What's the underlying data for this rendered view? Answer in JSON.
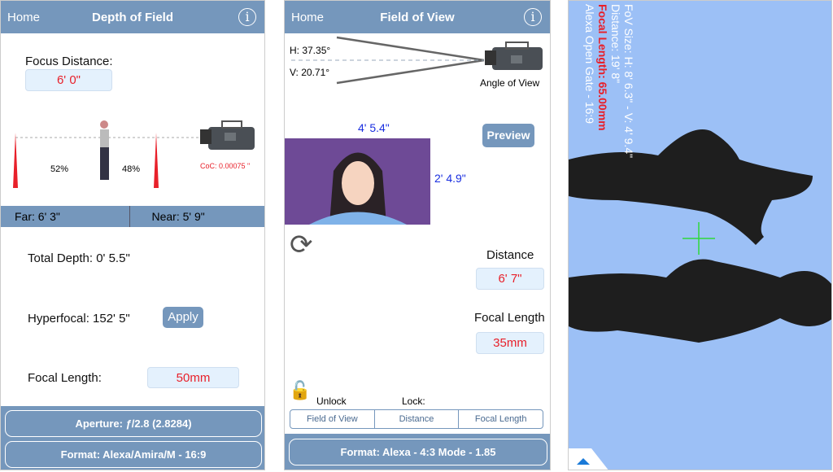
{
  "dof": {
    "home": "Home",
    "title": "Depth of Field",
    "focus_label": "Focus Distance:",
    "focus_value": "6' 0\"",
    "far_pct": "52%",
    "near_pct": "48%",
    "coc": "CoC: 0.00075 \"",
    "far": "Far: 6' 3\"",
    "near": "Near: 5' 9\"",
    "total_depth": "Total Depth: 0' 5.5\"",
    "hyperfocal": "Hyperfocal: 152' 5\"",
    "apply": "Apply",
    "focal_label": "Focal Length:",
    "focal_value": "50mm",
    "aperture": "Aperture: ƒ/2.8 (2.8284)",
    "format": "Format: Alexa/Amira/M - 16:9"
  },
  "fov": {
    "home": "Home",
    "title": "Field of View",
    "h_angle": "H: 37.35°",
    "v_angle": "V: 20.71°",
    "angle_label": "Angle of View",
    "width": "4' 5.4\"",
    "height": "2' 4.9\"",
    "preview": "Preview",
    "distance_label": "Distance",
    "distance_value": "6' 7\"",
    "focal_label": "Focal Length",
    "focal_value": "35mm",
    "unlock": "Unlock",
    "lock": "Lock:",
    "lock_options": [
      "Field of View",
      "Distance",
      "Focal Length"
    ],
    "format": "Format: Alexa - 4:3 Mode - 1.85"
  },
  "preview": {
    "fov_size": "FoV Size: H: 8' 6.3\" - V: 4' 9.4\"",
    "distance": "Distance: 19' 8\"",
    "focal_length": "Focal Length: 65.00mm",
    "format": "Alexa Open Gate - 16:9"
  },
  "colors": {
    "header": "#7597bc",
    "value_red": "#e8202a",
    "dimension_blue": "#1a2fe0",
    "preview_bg": "#9cc0f6",
    "crosshair": "#2fd83a"
  }
}
